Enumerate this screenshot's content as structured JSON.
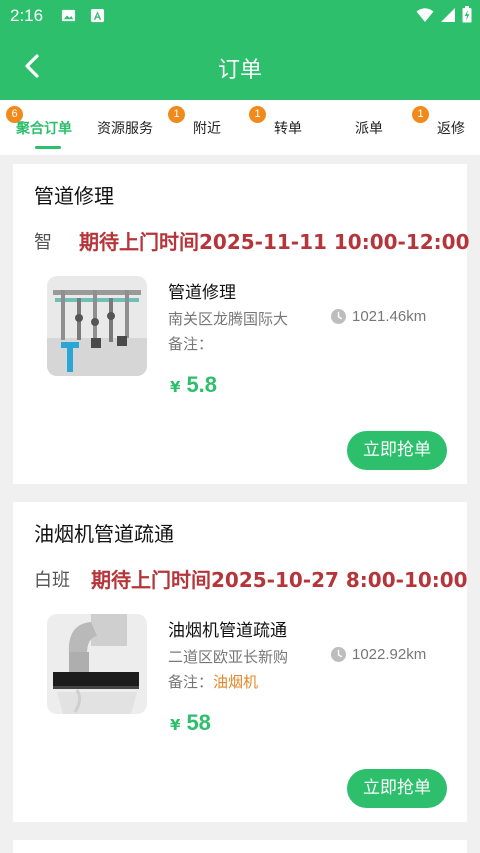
{
  "status_bar": {
    "time": "2:16"
  },
  "header": {
    "title": "订单"
  },
  "tabs": [
    {
      "label": "聚合订单",
      "badge": "6",
      "active": true
    },
    {
      "label": "资源服务",
      "badge": "",
      "active": false
    },
    {
      "label": "附近",
      "badge": "1",
      "active": false
    },
    {
      "label": "转单",
      "badge": "1",
      "active": false
    },
    {
      "label": "派单",
      "badge": "",
      "active": false
    },
    {
      "label": "返修",
      "badge": "1",
      "active": false
    }
  ],
  "orders": [
    {
      "title": "管道修理",
      "tag": "智",
      "appointment": "期待上门时间2025-11-11 10:00-12:00",
      "service_name": "管道修理",
      "address": "南关区龙腾国际大",
      "distance": "1021.46km",
      "note_label": "备注：",
      "note_value": "",
      "currency": "¥",
      "price": "5.8",
      "action": "立即抢单"
    },
    {
      "title": "油烟机管道疏通",
      "tag": "白班",
      "appointment": "期待上门时间2025-10-27 8:00-10:00",
      "service_name": "油烟机管道疏通",
      "address": "二道区欧亚长新购",
      "distance": "1022.92km",
      "note_label": "备注：",
      "note_value": "油烟机",
      "currency": "¥",
      "price": "58",
      "action": "立即抢单"
    }
  ],
  "colors": {
    "primary": "#2dbf6c",
    "badge": "#f08a1c",
    "appointment": "#b5353a",
    "note": "#e08a2a"
  }
}
